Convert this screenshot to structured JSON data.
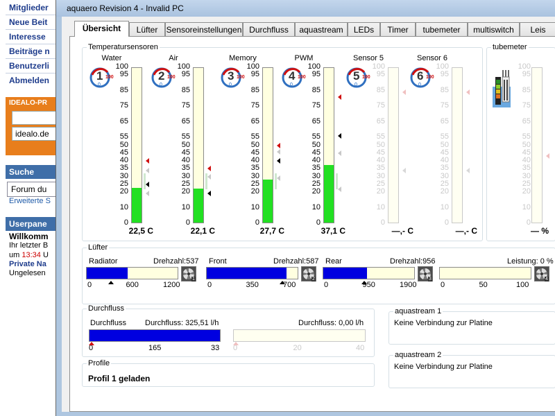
{
  "background_page": {
    "nav_links": [
      "Mitglieder",
      "Neue Beit",
      "Interesse",
      "Beiträge n",
      "Benutzerli",
      "Abmelden"
    ],
    "idealo_title": "IDEALO-PR",
    "idealo_input": "idealo.de",
    "search_head": "Suche",
    "search_input": "Forum du",
    "search_link": "Erweiterte S",
    "userpanel_head": "Userpane",
    "welcome": "Willkomm",
    "last_visit": "Ihr letzter B",
    "time_prefix": "um",
    "time_red": "13:34",
    "time_suffix": "U",
    "private": "Private Na",
    "unread": "Ungelesen"
  },
  "window": {
    "title": "aquaero Revision 4 - Invalid PC"
  },
  "tabs": [
    "Übersicht",
    "Lüfter",
    "Sensoreinstellungen",
    "Durchfluss",
    "aquastream",
    "LEDs",
    "Timer",
    "tubemeter",
    "multiswitch",
    "Leis"
  ],
  "temperature": {
    "group_title": "Temperatursensoren",
    "scale": [
      "100",
      "95",
      "85",
      "75",
      "65",
      "55",
      "50",
      "45",
      "40",
      "35",
      "30",
      "25",
      "20",
      "10",
      "0"
    ],
    "sensors": [
      {
        "name": "Water",
        "number": "1",
        "value": "22,5 C",
        "fill": 0.225,
        "enabled": true,
        "max_mark": "100",
        "min_mark": "0"
      },
      {
        "name": "Air",
        "number": "2",
        "value": "22,1 C",
        "fill": 0.221,
        "enabled": true,
        "max_mark": "100",
        "min_mark": "0"
      },
      {
        "name": "Memory",
        "number": "3",
        "value": "27,7 C",
        "fill": 0.277,
        "enabled": true,
        "max_mark": "100",
        "min_mark": "0"
      },
      {
        "name": "PWM",
        "number": "4",
        "value": "37,1 C",
        "fill": 0.371,
        "enabled": true,
        "max_mark": "100",
        "min_mark": "0"
      },
      {
        "name": "Sensor 5",
        "number": "5",
        "value": "—,- C",
        "fill": 0,
        "enabled": false,
        "max_mark": "100",
        "min_mark": "0"
      },
      {
        "name": "Sensor 6",
        "number": "6",
        "value": "—,- C",
        "fill": 0,
        "enabled": false,
        "max_mark": "100",
        "min_mark": "0"
      }
    ]
  },
  "tubemeter": {
    "group_title": "tubemeter",
    "scale": [
      "100",
      "95",
      "85",
      "75",
      "65",
      "55",
      "50",
      "45",
      "40",
      "35",
      "30",
      "25",
      "20",
      "10",
      "0"
    ],
    "value": "— %"
  },
  "fans": {
    "group_title": "Lüfter",
    "speed_prefix": "Drehzahl:",
    "items": [
      {
        "name": "Radiator",
        "speed": "537",
        "fill": 0.45,
        "scale": [
          "0",
          "600",
          "1200"
        ],
        "badge": "1"
      },
      {
        "name": "Front",
        "speed": "587",
        "fill": 0.88,
        "scale": [
          "0",
          "350",
          "700"
        ],
        "badge": "2"
      },
      {
        "name": "Rear",
        "speed": "956",
        "fill": 0.48,
        "scale": [
          "0",
          "950",
          "1900"
        ],
        "badge": "3"
      },
      {
        "name": "",
        "speed": "",
        "fill": 0,
        "scale": [
          "0",
          "50",
          "100"
        ],
        "badge": "4",
        "power_label": "Leistung: 0 %"
      }
    ]
  },
  "flow": {
    "group_title": "Durchfluss",
    "items": [
      {
        "name": "Durchfluss",
        "reading": "Durchfluss: 325,51 l/h",
        "fill": 1.0,
        "scale": [
          "0",
          "165",
          "33"
        ]
      },
      {
        "name": "",
        "reading": "Durchfluss: 0,00 l/h",
        "fill": 0,
        "scale": [
          "0",
          "20",
          "40"
        ]
      }
    ]
  },
  "aquastream": [
    {
      "title": "aquastream 1",
      "status": "Keine Verbindung zur Platine"
    },
    {
      "title": "aquastream 2",
      "status": "Keine Verbindung zur Platine"
    }
  ],
  "profile": {
    "group_title": "Profile",
    "status": "Profil 1 geladen"
  },
  "colors": {
    "bar_green": "#22e022",
    "bar_blue": "#0000e0",
    "bar_background": "#ffffe0",
    "gauge_red": "#d01010",
    "gauge_blue": "#1060c0"
  }
}
